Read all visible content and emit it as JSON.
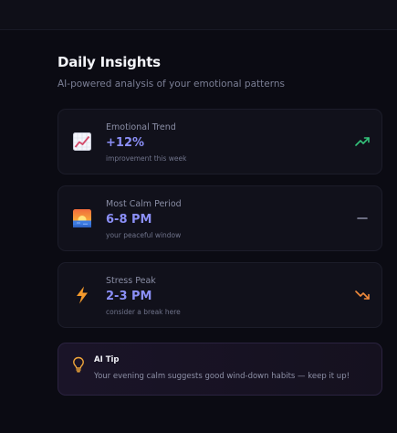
{
  "header": {
    "title": "Daily Insights",
    "subtitle": "AI-powered analysis of your emotional patterns"
  },
  "insights": [
    {
      "label": "Emotional Trend",
      "value": "+12%",
      "note": "improvement this week",
      "icon": "chart-increasing-icon",
      "trend": "up",
      "trend_color": "#34c37b"
    },
    {
      "label": "Most Calm Period",
      "value": "6-8 PM",
      "note": "your peaceful window",
      "icon": "sunset-icon",
      "trend": "neutral",
      "trend_color": "#8a8ea5"
    },
    {
      "label": "Stress Peak",
      "value": "2-3 PM",
      "note": "consider a break here",
      "icon": "lightning-icon",
      "trend": "down",
      "trend_color": "#f08a3b"
    }
  ],
  "tip": {
    "title": "AI Tip",
    "text": "Your evening calm suggests good wind-down habits — keep it up!",
    "icon": "lightbulb-icon"
  },
  "colors": {
    "background": "#0b0b13",
    "card": "#11111b",
    "accent": "#8b8ff7"
  }
}
